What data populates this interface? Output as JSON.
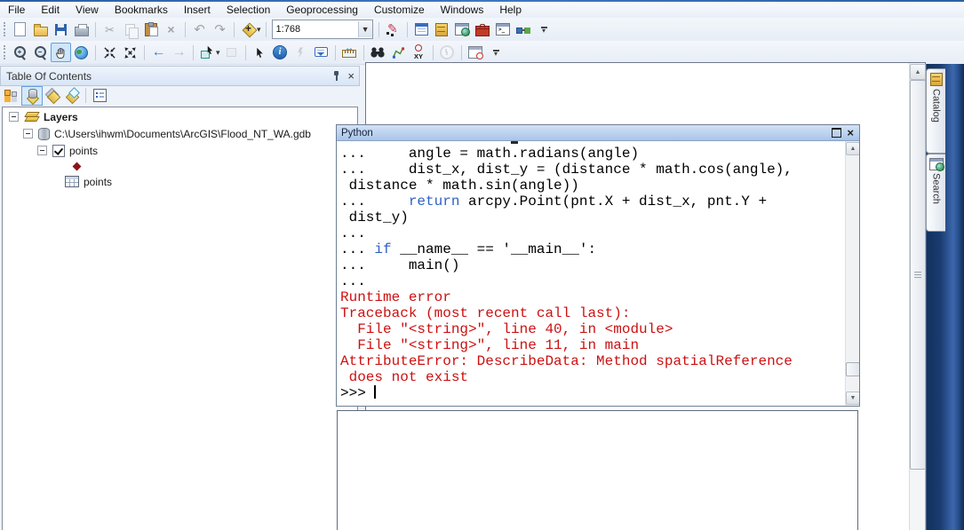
{
  "menu_bar": {
    "items": [
      "File",
      "Edit",
      "View",
      "Bookmarks",
      "Insert",
      "Selection",
      "Geoprocessing",
      "Customize",
      "Windows",
      "Help"
    ]
  },
  "toolbar_standard": {
    "scale_value": "1:768",
    "icons": [
      "new-document",
      "open",
      "save",
      "print",
      "cut",
      "copy",
      "paste",
      "delete",
      "undo",
      "redo",
      "add-data",
      "scale-combo",
      "edit-vertices",
      "table-options",
      "arccatalog",
      "catalog-window",
      "arctoolbox",
      "python-window",
      "modelbuilder",
      "toolbar-overflow"
    ]
  },
  "toolbar_tools": {
    "icons": [
      "zoom-in",
      "zoom-out",
      "pan",
      "full-extent",
      "fixed-zoom-in",
      "fixed-zoom-out",
      "back",
      "forward",
      "select-features",
      "clear-selection",
      "select-elements",
      "identify",
      "hyperlink",
      "html-popup",
      "measure",
      "find",
      "find-route",
      "go-to-xy",
      "time-slider",
      "viewer-window",
      "toolbar-overflow"
    ],
    "active_tool": "pan"
  },
  "toc": {
    "title": "Table Of Contents",
    "toolbar_icons": [
      "list-by-drawing-order",
      "list-by-source",
      "list-by-visibility",
      "list-by-selection",
      "toc-options"
    ],
    "selected_mode": "list-by-source",
    "tree": {
      "root_label": "Layers",
      "gdb_label": "C:\\Users\\ihwm\\Documents\\ArcGIS\\Flood_NT_WA.gdb",
      "layer_label": "points",
      "layer_checked": true,
      "table_label": "points"
    }
  },
  "python_window": {
    "title": "Python",
    "colors": {
      "code": "#000000",
      "keyword": "#2e5fc4",
      "error": "#cc1111"
    },
    "lines": [
      {
        "segments": [
          {
            "text": "...     angle = math.radians(angle)",
            "color": "code"
          }
        ]
      },
      {
        "segments": [
          {
            "text": "...     dist_x, dist_y = (distance * math.cos(angle),",
            "color": "code"
          }
        ]
      },
      {
        "segments": [
          {
            "text": " distance * math.sin(angle))",
            "color": "code"
          }
        ]
      },
      {
        "segments": [
          {
            "text": "...     ",
            "color": "code"
          },
          {
            "text": "return",
            "color": "keyword"
          },
          {
            "text": " arcpy.Point(pnt.X + dist_x, pnt.Y +",
            "color": "code"
          }
        ]
      },
      {
        "segments": [
          {
            "text": " dist_y)",
            "color": "code"
          }
        ]
      },
      {
        "segments": [
          {
            "text": "...",
            "color": "code"
          }
        ]
      },
      {
        "segments": [
          {
            "text": "... ",
            "color": "code"
          },
          {
            "text": "if",
            "color": "keyword"
          },
          {
            "text": " __name__ == '__main__':",
            "color": "code"
          }
        ]
      },
      {
        "segments": [
          {
            "text": "...     main()",
            "color": "code"
          }
        ]
      },
      {
        "segments": [
          {
            "text": "...",
            "color": "code"
          }
        ]
      },
      {
        "segments": [
          {
            "text": "Runtime error",
            "color": "error"
          }
        ]
      },
      {
        "segments": [
          {
            "text": "Traceback (most recent call last):",
            "color": "error"
          }
        ]
      },
      {
        "segments": [
          {
            "text": "  File \"<string>\", line 40, in <module>",
            "color": "error"
          }
        ]
      },
      {
        "segments": [
          {
            "text": "  File \"<string>\", line 11, in main",
            "color": "error"
          }
        ]
      },
      {
        "segments": [
          {
            "text": "AttributeError: DescribeData: Method spatialReference",
            "color": "error"
          }
        ]
      },
      {
        "segments": [
          {
            "text": " does not exist",
            "color": "error"
          }
        ]
      },
      {
        "segments": [
          {
            "text": ">>> ",
            "color": "code"
          }
        ],
        "cursor": true
      }
    ]
  },
  "dock_tabs": [
    {
      "label": "Catalog",
      "icon": "catalog-cabinet-icon"
    },
    {
      "label": "Search",
      "icon": "search-window-icon"
    }
  ],
  "colors": {
    "titlebar_blue": "#b9cfec",
    "dock_navy": "#1a3c70",
    "selection_highlight": "#62a0dc",
    "error_red": "#cc1111",
    "keyword_blue": "#2e5fc4"
  }
}
